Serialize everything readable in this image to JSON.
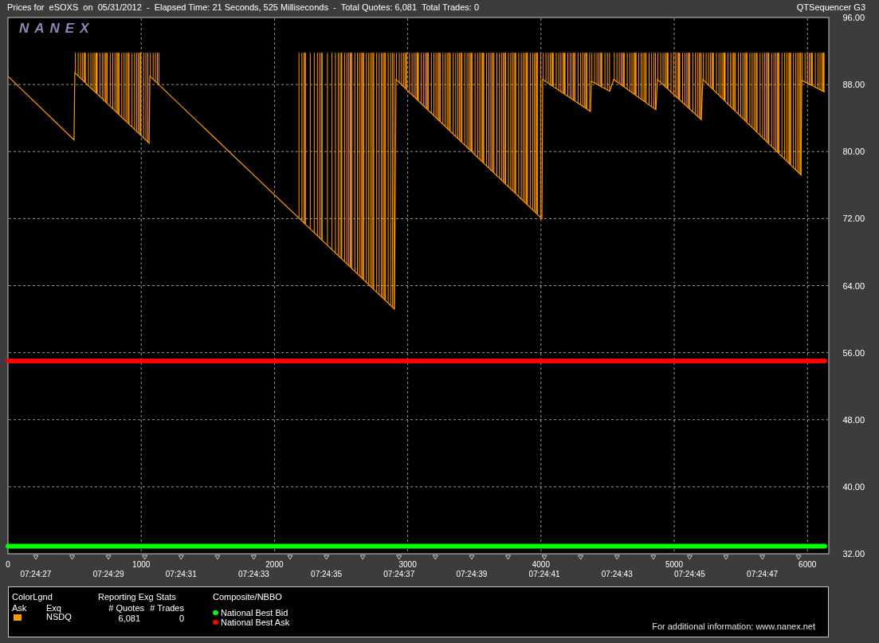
{
  "header": {
    "title": "Prices for  eSOXS  on  05/31/2012  -  Elapsed Time: 21 Seconds, 525 Milliseconds  -  Total Quotes: 6,081  Total Trades: 0",
    "app_name": "QTSequencer G3"
  },
  "chart": {
    "logo": "NANEX",
    "chart_data": {
      "type": "line",
      "x": [
        0,
        496,
        502,
        1059,
        1065,
        2900,
        2912,
        4007,
        4013,
        4372,
        4378,
        4516,
        4546,
        4862,
        4874,
        5203,
        5215,
        5951,
        5957,
        6130
      ],
      "series": [
        {
          "name": "Ask",
          "color": "#ff9900",
          "values": [
            89.0,
            81.4,
            89.4,
            81.0,
            89.0,
            61.2,
            88.6,
            72.0,
            88.6,
            84.8,
            88.4,
            87.2,
            88.6,
            85.0,
            88.6,
            83.8,
            88.6,
            77.2,
            88.5,
            87.1
          ]
        },
        {
          "name": "National Best Ask",
          "color": "#ff0000",
          "values": [
            55,
            55,
            55,
            55,
            55,
            55,
            55,
            55,
            55,
            55,
            55,
            55,
            55,
            55,
            55,
            55,
            55,
            55,
            55,
            55
          ]
        },
        {
          "name": "National Best Bid",
          "color": "#00ff00",
          "values": [
            32.9,
            32.9,
            32.9,
            32.9,
            32.9,
            32.9,
            32.9,
            32.9,
            32.9,
            32.9,
            32.9,
            32.9,
            32.9,
            32.9,
            32.9,
            32.9,
            32.9,
            32.9,
            32.9,
            32.9
          ]
        }
      ],
      "grid": true,
      "xlim": [
        0,
        6160
      ],
      "ylim": [
        32,
        96
      ],
      "xticks": [
        0,
        1000,
        2000,
        3000,
        4000,
        5000,
        6000
      ],
      "yticks": [
        {
          "value": 32,
          "label": "32.00"
        },
        {
          "value": 40,
          "label": "40.00"
        },
        {
          "value": 48,
          "label": "48.00"
        },
        {
          "value": 56,
          "label": "56.00"
        },
        {
          "value": 64,
          "label": "64.00"
        },
        {
          "value": 72,
          "label": "72.00"
        },
        {
          "value": 80,
          "label": "80.00"
        },
        {
          "value": 88,
          "label": "88.00"
        },
        {
          "value": 96,
          "label": "96.00"
        }
      ]
    },
    "time_labels": [
      "07:24:27",
      "07:24:29",
      "07:24:31",
      "07:24:33",
      "07:24:35",
      "07:24:37",
      "07:24:39",
      "07:24:41",
      "07:24:43",
      "07:24:45",
      "07:24:47"
    ]
  },
  "legend": {
    "color_legend": {
      "title": "ColorLgnd",
      "columns": [
        "Exq"
      ],
      "rows": [
        {
          "exchange": "NSDQ"
        }
      ]
    },
    "exchange_stats": {
      "title": "Reporting Exg Stats",
      "columns": [
        "# Quotes",
        "# Trades"
      ],
      "rows": [
        {
          "quotes": "6,081",
          "trades": "0"
        }
      ]
    },
    "nbbo": {
      "title": "Composite/NBBO"
    },
    "footer": "For additional information: www.nanex.net"
  }
}
